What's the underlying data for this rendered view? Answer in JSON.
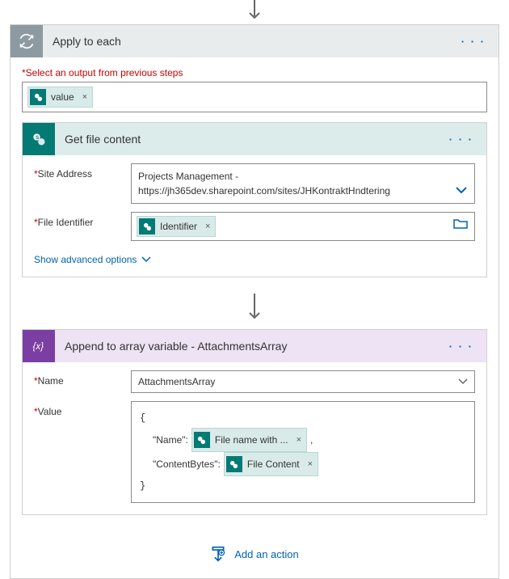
{
  "arrow": {},
  "applyEach": {
    "title": "Apply to each",
    "selectLabel": "Select an output from previous steps",
    "token_value": "value"
  },
  "getFile": {
    "title": "Get file content",
    "site_label": "Site Address",
    "site_value_line1": "Projects Management -",
    "site_value_line2": "https://jh365dev.sharepoint.com/sites/JHKontraktHndtering",
    "file_label": "File Identifier",
    "token_identifier": "Identifier",
    "adv": "Show advanced options"
  },
  "append": {
    "title": "Append to array variable - AttachmentsArray",
    "name_label": "Name",
    "name_value": "AttachmentsArray",
    "value_label": "Value",
    "brace_open": "{",
    "kv_name_key": "\"Name\":",
    "token_filename": "File name with ...",
    "comma": ",",
    "kv_cb_key": "\"ContentBytes\":",
    "token_filecontent": "File Content",
    "brace_close": "}"
  },
  "addAction": "Add an action",
  "x": "×"
}
